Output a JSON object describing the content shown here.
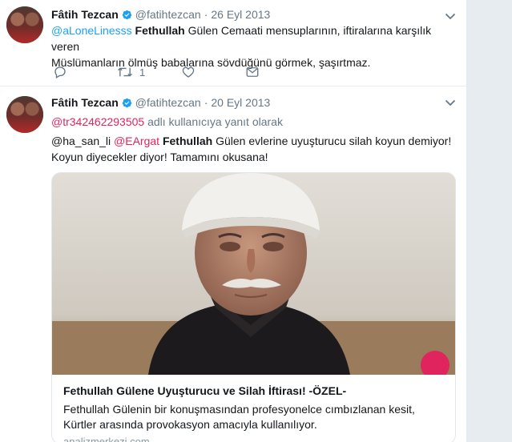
{
  "tweet1": {
    "author_name": "Fâtih Tezcan",
    "author_handle": "@fatihtezcan",
    "separator": "·",
    "time": "26 Eyl 2013",
    "text_parts": {
      "mention": "@aLoneLinesss",
      "bold": "Fethullah",
      "rest_line1": " Gülen Cemaati mensuplarının, iftiralarına karşılık veren",
      "rest_line2": "Müslümanların ölmüş babalarına sövdüğünü görmek, şaşırtmaz."
    },
    "retweet_count": "1"
  },
  "tweet2": {
    "author_name": "Fâtih Tezcan",
    "author_handle": "@fatihtezcan",
    "separator": "·",
    "time": "20 Eyl 2013",
    "reply_to": {
      "user": "@tr342462293505",
      "suffix": " adlı kullanıcıya yanıt olarak"
    },
    "text_parts": {
      "mention1": "@ha_san_li",
      "mention2": "@EArgat",
      "bold": "Fethullah",
      "rest_line1": " Gülen evlerine uyuşturucu silah koyun demiyor!",
      "line2": "Koyun diyecekler diyor! Tamamını okusana!"
    },
    "card": {
      "title": "Fethullah Gülene Uyuşturucu ve Silah İftirası! -ÖZEL-",
      "description_line1": "Fethullah Gülenin bir konuşmasından profesyonelce cımbızlanan kesit,",
      "description_line2": "Kürtler arasında provokasyon amacıyla kullanılıyor.",
      "domain": "analizmerkezi.com"
    }
  },
  "colors": {
    "accent": "#1da1f2",
    "reply_red": "#e0245e",
    "muted": "#657786",
    "divider": "#e6ecf0"
  },
  "icons": [
    "verified-badge-icon",
    "chevron-down-icon",
    "reply-icon",
    "retweet-icon",
    "like-icon",
    "message-icon"
  ]
}
